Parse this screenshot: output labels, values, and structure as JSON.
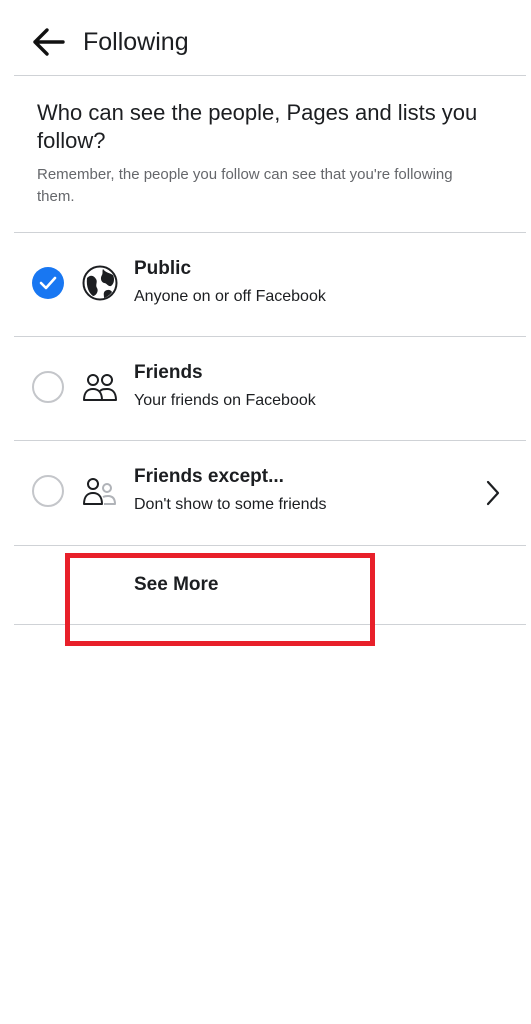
{
  "header": {
    "title": "Following",
    "back_icon": "arrow-left-icon"
  },
  "intro": {
    "question": "Who can see the people, Pages and lists you follow?",
    "note": "Remember, the people you follow can see that you're following them."
  },
  "options": [
    {
      "id": "public",
      "title": "Public",
      "subtitle": "Anyone on or off Facebook",
      "selected": true,
      "icon": "globe-icon"
    },
    {
      "id": "friends",
      "title": "Friends",
      "subtitle": "Your friends on Facebook",
      "selected": false,
      "icon": "friends-icon"
    },
    {
      "id": "friends-except",
      "title": "Friends except...",
      "subtitle": "Don't show to some friends",
      "selected": false,
      "icon": "friends-except-icon",
      "has_chevron": true
    }
  ],
  "see_more": {
    "label": "See More"
  },
  "colors": {
    "accent": "#1877f2",
    "highlight": "#e8202a",
    "divider": "#cfd2d6",
    "secondary_text": "#65676b"
  }
}
